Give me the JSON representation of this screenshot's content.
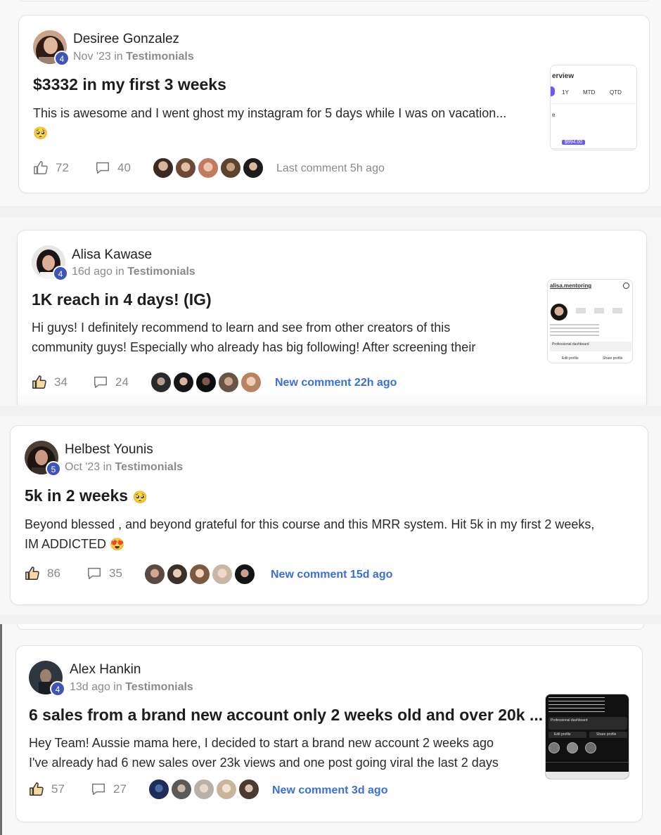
{
  "posts": [
    {
      "author": "Desiree Gonzalez",
      "level": "4",
      "date": "Nov '23",
      "in_word": "in",
      "category": "Testimonials",
      "title": "$3332 in my first 3 weeks",
      "body_line1": "This is awesome and I went ghost my instagram for 5 days while I was on vacation...",
      "body_emoji": "🥺",
      "likes": "72",
      "comments": "40",
      "comment_status": "Last comment 5h ago",
      "thumb": {
        "t1": "erview",
        "t2": "1Y",
        "t3": "MTD",
        "t4": "QTD",
        "t5": "e",
        "t6": "$994.00"
      }
    },
    {
      "author": "Alisa Kawase",
      "level": "4",
      "date": "16d ago",
      "in_word": "in",
      "category": "Testimonials",
      "title": "1K reach in 4 days! (IG)",
      "body_line1": "Hi guys! I definitely recommend to learn and see from other creators of this",
      "body_line2": "community guys! Especially who already has big following! After screening their",
      "likes": "34",
      "comments": "24",
      "comment_status": "New comment 22h ago",
      "thumb": {
        "t1": "alisa.mentoring",
        "t2": "Professional dashboard",
        "t3": "Edit profile",
        "t4": "Share profile"
      }
    },
    {
      "author": "Helbest Younis",
      "level": "5",
      "date": "Oct '23",
      "in_word": "in",
      "category": "Testimonials",
      "title": "5k in 2 weeks",
      "title_emoji": "🥺",
      "body_line1": "Beyond blessed , and beyond grateful for this course and this MRR system. Hit 5k in my first 2 weeks,",
      "body_line2": "IM ADDICTED",
      "body_emoji": "😍",
      "likes": "86",
      "comments": "35",
      "comment_status": "New comment 15d ago"
    },
    {
      "author": "Alex Hankin",
      "level": "4",
      "date": "13d ago",
      "in_word": "in",
      "category": "Testimonials",
      "title": "6 sales from a brand new account only 2 weeks old and over 20k ...",
      "body_line1": "Hey Team! Aussie mama here, I decided to start a brand new account 2 weeks ago",
      "body_line2": "I've already had 6 new sales over 23k views and one post going viral the last 2 days",
      "likes": "57",
      "comments": "27",
      "comment_status": "New comment 3d ago",
      "thumb": {
        "t1": "Professional dashboard",
        "t2": "Edit profile",
        "t3": "Share profile"
      }
    }
  ],
  "colors": {
    "badge": "#3d54b8",
    "new_comment": "#3a6fd8",
    "muted": "#8a8a8e"
  },
  "icons": {
    "like": "thumbs-up-icon",
    "comment": "comment-bubble-icon"
  }
}
